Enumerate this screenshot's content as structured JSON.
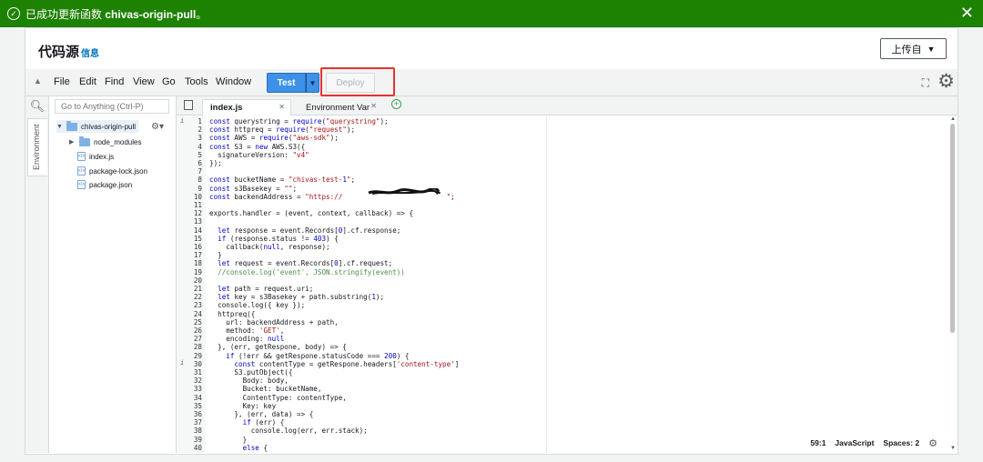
{
  "banner": {
    "message_prefix": "已成功更新函数 ",
    "function_name": "chivas-origin-pull",
    "message_suffix": "。",
    "check_icon": "check-circle-icon",
    "close_icon": "close-icon"
  },
  "header": {
    "title": "代码源",
    "info_link": "信息",
    "upload_label": "上传自"
  },
  "toolbar": {
    "menus": [
      "File",
      "Edit",
      "Find",
      "View",
      "Go",
      "Tools",
      "Window"
    ],
    "test_label": "Test",
    "deploy_label": "Deploy"
  },
  "sidebar": {
    "rail_tab": "Environment",
    "search_placeholder": "Go to Anything (Ctrl-P)",
    "root_folder": "chivas-origin-pull",
    "items": [
      {
        "label": "node_modules",
        "type": "folder"
      },
      {
        "label": "index.js",
        "type": "file"
      },
      {
        "label": "package-lock.json",
        "type": "file"
      },
      {
        "label": "package.json",
        "type": "file"
      }
    ]
  },
  "tabs": [
    {
      "label": "index.js",
      "active": true
    },
    {
      "label": "Environment Var",
      "active": false
    }
  ],
  "editor": {
    "code_lines": [
      "const querystring = require(\"querystring\");",
      "const httpreq = require(\"request\");",
      "const AWS = require(\"aws-sdk\");",
      "const S3 = new AWS.S3({",
      "  signatureVersion: \"v4\"",
      "});",
      "",
      "const bucketName = \"chivas-test-1\";",
      "const s3Basekey = \"\";",
      "const backendAddress = \"https://                         \";",
      "",
      "exports.handler = (event, context, callback) => {",
      "",
      "  let response = event.Records[0].cf.response;",
      "  if (response.status != 403) {",
      "    callback(null, response);",
      "  }",
      "  let request = event.Records[0].cf.request;",
      "  //console.log('event', JSON.stringify(event))",
      "",
      "  let path = request.uri;",
      "  let key = s3Basekey + path.substring(1);",
      "  console.log({ key });",
      "  httpreq({",
      "    url: backendAddress + path,",
      "    method: 'GET',",
      "    encoding: null",
      "  }, (err, getRespone, body) => {",
      "    if (!err && getRespone.statusCode === 200) {",
      "      const contentType = getRespone.headers['content-type']",
      "      S3.putObject({",
      "        Body: body,",
      "        Bucket: bucketName,",
      "        ContentType: contentType,",
      "        Key: key",
      "      }, (err, data) => {",
      "        if (err) {",
      "          console.log(err, err.stack);",
      "        }",
      "        else {"
    ],
    "line_numbers": [
      "1",
      "2",
      "3",
      "4",
      "5",
      "6",
      "7",
      "8",
      "9",
      "10",
      "11",
      "12",
      "13",
      "14",
      "15",
      "16",
      "17",
      "18",
      "19",
      "20",
      "21",
      "22",
      "23",
      "24",
      "25",
      "26",
      "27",
      "28",
      "29",
      "30",
      "31",
      "32",
      "33",
      "34",
      "35",
      "36",
      "37",
      "38",
      "39",
      "40"
    ]
  },
  "status": {
    "position": "59:1",
    "language": "JavaScript",
    "spaces": "Spaces: 2"
  },
  "colors": {
    "banner_bg": "#1d8102",
    "test_button": "#3d92e8",
    "deploy_highlight": "#e3342f",
    "link": "#0073bb"
  }
}
